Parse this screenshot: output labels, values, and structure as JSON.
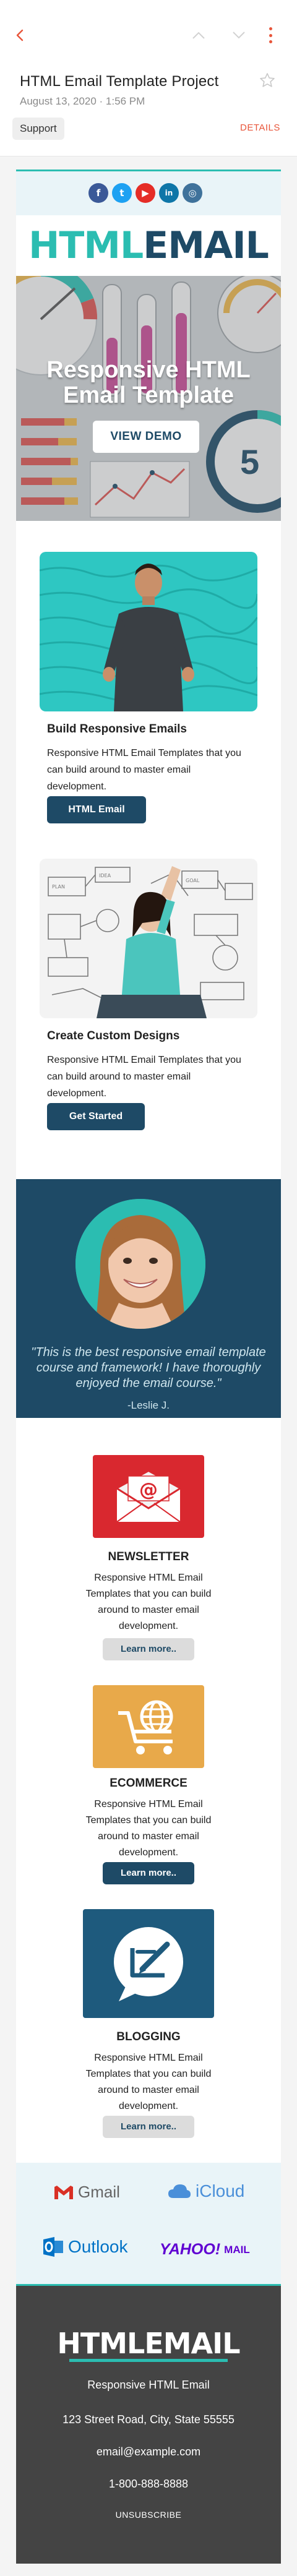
{
  "header": {
    "subject": "HTML Email Template Project",
    "date": "August 13, 2020 · 1:56 PM",
    "label": "Support",
    "details_link": "DETAILS",
    "accent_color": "#e8553a"
  },
  "email": {
    "social": [
      {
        "name": "facebook-icon",
        "glyph": "f",
        "color": "#3b5998"
      },
      {
        "name": "twitter-icon",
        "glyph": "t",
        "color": "#1da1f2"
      },
      {
        "name": "youtube-icon",
        "glyph": "▶",
        "color": "#e52d27"
      },
      {
        "name": "linkedin-icon",
        "glyph": "in",
        "color": "#0e76a8"
      },
      {
        "name": "instagram-icon",
        "glyph": "◎",
        "color": "#3f729b"
      }
    ],
    "brand": {
      "part1": "HTML",
      "part2": "EMAIL",
      "color1": "#2bbdb1",
      "color2": "#1e4a66"
    },
    "hero": {
      "title": "Responsive HTML Email Template",
      "button": "VIEW DEMO"
    },
    "cards": [
      {
        "title": "Build Responsive Emails",
        "text": "Responsive HTML Email Templates that you can build around to master email development.",
        "button": "HTML Email"
      },
      {
        "title": "Create Custom Designs",
        "text": "Responsive HTML Email Templates that you can build around to master email development.",
        "button": "Get Started"
      }
    ],
    "testimonial": {
      "quote": "\"This is the best responsive email template course and framework! I have thoroughly enjoyed the email course.\"",
      "author": "-Leslie J."
    },
    "features": [
      {
        "title": "NEWSLETTER",
        "text": "Responsive HTML Email Templates that you can build around to master email development.",
        "button": "Learn more..",
        "color": "#d9282f"
      },
      {
        "title": "ECOMMERCE",
        "text": "Responsive HTML Email Templates that you can build around to master email development.",
        "button": "Learn more..",
        "color": "#e8a94a"
      },
      {
        "title": "BLOGGING",
        "text": "Responsive HTML Email Templates that you can build around to master email development.",
        "button": "Learn more..",
        "color": "#1e5a7d"
      }
    ],
    "partners": [
      {
        "name": "Gmail",
        "color": "#666666",
        "accent": "#d93025"
      },
      {
        "name": "iCloud",
        "color": "#4a8fd9",
        "accent": "#4a8fd9"
      },
      {
        "name": "Outlook",
        "color": "#0072c6",
        "accent": "#0072c6"
      },
      {
        "name": "YAHOO!",
        "suffix": "MAIL",
        "color": "#6001d2",
        "accent": "#6001d2"
      }
    ],
    "footer": {
      "brand": "HTMLEMAIL",
      "tagline": "Responsive HTML Email",
      "address": "123 Street Road, City, State 55555",
      "email": "email@example.com",
      "phone": "1-800-888-8888",
      "unsubscribe": "UNSUBSCRIBE"
    }
  }
}
